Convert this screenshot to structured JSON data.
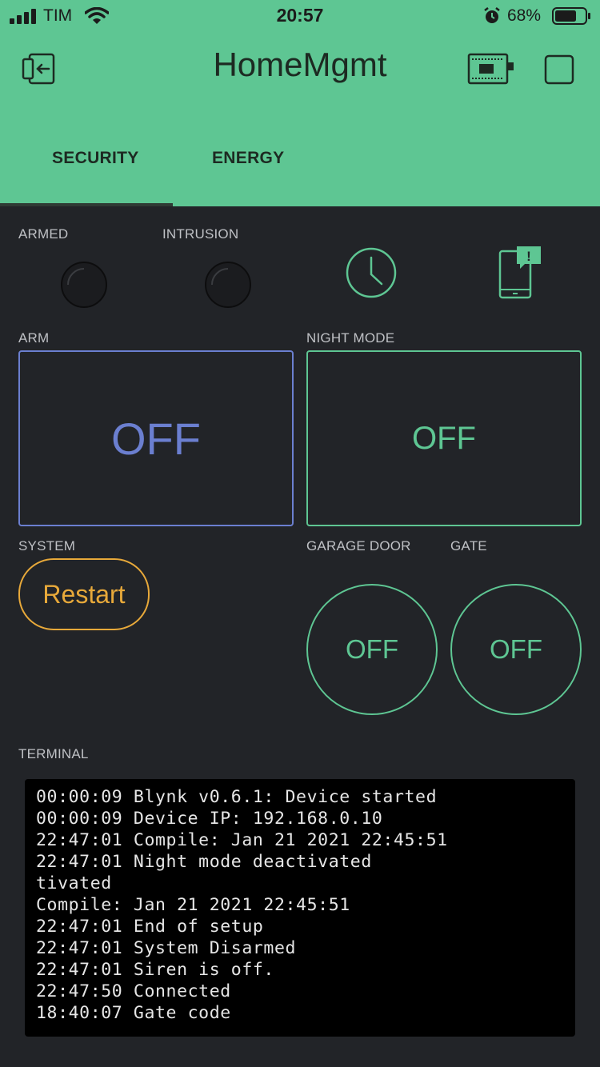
{
  "status_bar": {
    "carrier": "TIM",
    "time": "20:57",
    "battery": "68%"
  },
  "header": {
    "title": "HomeMgmt",
    "tabs": [
      {
        "label": "SECURITY",
        "active": true
      },
      {
        "label": "ENERGY",
        "active": false
      }
    ]
  },
  "widgets": {
    "armed_label": "ARMED",
    "intrusion_label": "INTRUSION",
    "arm": {
      "label": "ARM",
      "value": "OFF"
    },
    "night_mode": {
      "label": "NIGHT MODE",
      "value": "OFF"
    },
    "system": {
      "label": "SYSTEM",
      "button": "Restart"
    },
    "garage_door": {
      "label": "GARAGE DOOR",
      "value": "OFF"
    },
    "gate": {
      "label": "GATE",
      "value": "OFF"
    }
  },
  "terminal": {
    "label": "TERMINAL",
    "lines": [
      "00:00:09 Blynk v0.6.1: Device started",
      "00:00:09 Device IP: 192.168.0.10",
      "22:47:01 Compile: Jan 21 2021 22:45:51",
      "22:47:01 Night mode deactivated",
      "tivated",
      "Compile: Jan 21 2021 22:45:51",
      "22:47:01 End of setup",
      "22:47:01 System Disarmed",
      "22:47:01 Siren is off.",
      "22:47:50 Connected",
      "18:40:07 Gate code"
    ]
  },
  "colors": {
    "header_bg": "#5ec693",
    "body_bg": "#222428",
    "accent_green": "#5ec693",
    "accent_blue": "#6b7fd0",
    "accent_orange": "#e8a93a"
  },
  "icons": {
    "back": "exit-app-icon",
    "device": "device-board-icon",
    "square": "square-icon",
    "timer": "clock-icon",
    "notification": "phone-notification-icon"
  }
}
